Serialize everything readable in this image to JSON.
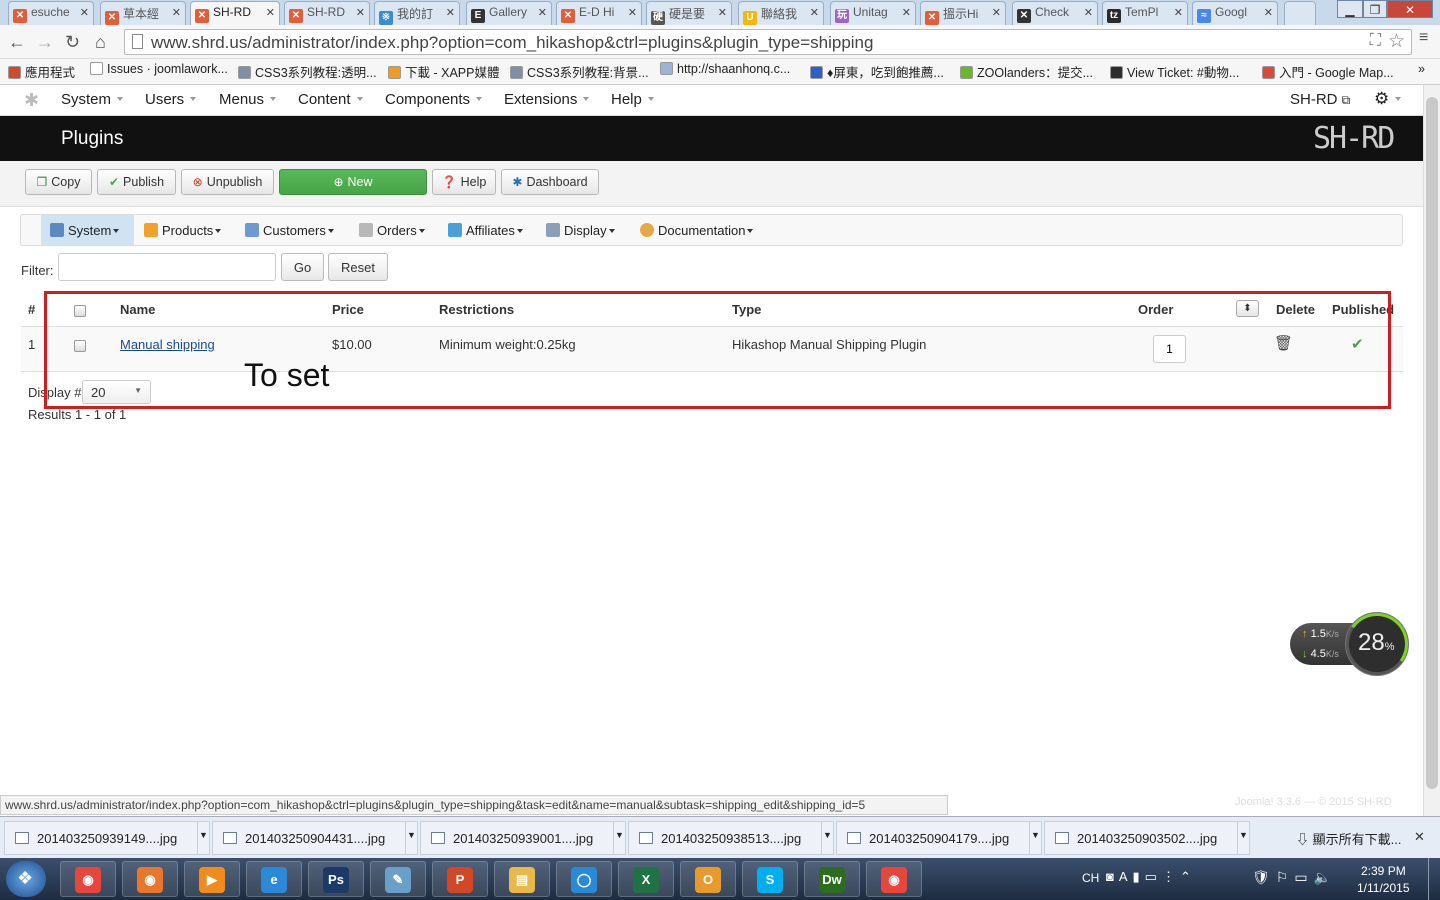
{
  "browser": {
    "tabs": [
      {
        "label": "esuche",
        "fav_color": "#e45d3a",
        "fav_glyph": "✕"
      },
      {
        "label": "草本經",
        "fav_color": "#e45d3a",
        "fav_glyph": "✕"
      },
      {
        "label": "SH-RD",
        "fav_color": "#e45d3a",
        "fav_glyph": "✕",
        "active": true
      },
      {
        "label": "SH-RD",
        "fav_color": "#e45d3a",
        "fav_glyph": "✕"
      },
      {
        "label": "我的訂",
        "fav_color": "#3a8ad6",
        "fav_glyph": "※"
      },
      {
        "label": "Gallery",
        "fav_color": "#333333",
        "fav_glyph": "E"
      },
      {
        "label": "E-D Hi",
        "fav_color": "#e45d3a",
        "fav_glyph": "✕"
      },
      {
        "label": "硬是要",
        "fav_color": "#555555",
        "fav_glyph": "硬"
      },
      {
        "label": "聯絡我",
        "fav_color": "#f2b90c",
        "fav_glyph": "U"
      },
      {
        "label": "Unitag",
        "fav_color": "#a064c8",
        "fav_glyph": "玩"
      },
      {
        "label": "搵示Hi",
        "fav_color": "#e45d3a",
        "fav_glyph": "✕"
      },
      {
        "label": "Check",
        "fav_color": "#333333",
        "fav_glyph": "✕"
      },
      {
        "label": "TemPl",
        "fav_color": "#2a2a2a",
        "fav_glyph": "tz"
      },
      {
        "label": "Googl",
        "fav_color": "#4a88e8",
        "fav_glyph": "≈"
      }
    ],
    "url": "www.shrd.us/administrator/index.php?option=com_hikashop&ctrl=plugins&plugin_type=shipping",
    "bookmarks": [
      {
        "label": "應用程式",
        "color": "#d04a2a"
      },
      {
        "label": "Issues · joomlawork...",
        "color": "#ffffff"
      },
      {
        "label": "CSS3系列教程:透明...",
        "color": "#7f8fa6"
      },
      {
        "label": "下載 - XAPP媒體",
        "color": "#f19a1c"
      },
      {
        "label": "CSS3系列教程:背景...",
        "color": "#7f8fa6"
      },
      {
        "label": "http://shaanhonq.c...",
        "color": "#9db4d6"
      },
      {
        "label": "♦屏東，吃到飽推薦...",
        "color": "#2d5fc7"
      },
      {
        "label": "ZOOlanders：提交...",
        "color": "#6ab82a"
      },
      {
        "label": "View Ticket: #動物...",
        "color": "#2d2d2d"
      },
      {
        "label": "入門 - Google Map...",
        "color": "#d94a3a"
      }
    ]
  },
  "joomla_menu": {
    "items": [
      "System",
      "Users",
      "Menus",
      "Content",
      "Components",
      "Extensions",
      "Help"
    ],
    "site_link": "SH-RD",
    "settings_icon": "gear-icon"
  },
  "header": {
    "title": "Plugins",
    "logo": "SH-RD"
  },
  "toolbar": {
    "copy": "Copy",
    "publish": "Publish",
    "unpublish": "Unpublish",
    "new": "New",
    "help": "Help",
    "dashboard": "Dashboard"
  },
  "hikashop_menu": [
    "System",
    "Products",
    "Customers",
    "Orders",
    "Affiliates",
    "Display",
    "Documentation"
  ],
  "filter": {
    "label": "Filter:",
    "value": "",
    "go": "Go",
    "reset": "Reset"
  },
  "table": {
    "headers": {
      "num": "#",
      "name": "Name",
      "price": "Price",
      "restrictions": "Restrictions",
      "type": "Type",
      "order": "Order",
      "delete": "Delete",
      "published": "Published"
    },
    "rows": [
      {
        "num": "1",
        "name": "Manual shipping",
        "price": "$10.00",
        "restrictions": "Minimum weight:0.25kg",
        "type": "Hikashop Manual Shipping Plugin",
        "order": "1",
        "published": true
      }
    ]
  },
  "annotation": {
    "text": "To set",
    "color": "#cc1f1f"
  },
  "pagination": {
    "display_label": "Display #",
    "display_value": "20",
    "results": "Results 1 - 1 of 1"
  },
  "footer_note": "Joomla! 3.3.6 — © 2015 SH-RD",
  "network_widget": {
    "up": "1.5",
    "down": "4.5",
    "unit": "K/s",
    "percent": "28",
    "percent_sign": "%"
  },
  "status_url": "www.shrd.us/administrator/index.php?option=com_hikashop&ctrl=plugins&plugin_type=shipping&task=edit&name=manual&subtask=shipping_edit&shipping_id=5",
  "downloads": {
    "files": [
      "201403250939149....jpg",
      "201403250904431....jpg",
      "201403250939001....jpg",
      "201403250938513....jpg",
      "201403250904179....jpg",
      "201403250903502....jpg"
    ],
    "show_all": "顯示所有下載..."
  },
  "taskbar": {
    "apps": [
      {
        "name": "chrome",
        "glyph": "◉",
        "color": "#e8453c"
      },
      {
        "name": "firefox",
        "glyph": "◉",
        "color": "#e8772c"
      },
      {
        "name": "media-player",
        "glyph": "▶",
        "color": "#f08c1c"
      },
      {
        "name": "internet-explorer",
        "glyph": "e",
        "color": "#2a8ad8"
      },
      {
        "name": "photoshop",
        "glyph": "Ps",
        "color": "#1b3a68"
      },
      {
        "name": "notepad",
        "glyph": "✎",
        "color": "#6aa0c8"
      },
      {
        "name": "powerpoint",
        "glyph": "P",
        "color": "#d24726"
      },
      {
        "name": "file-explorer",
        "glyph": "▤",
        "color": "#e8b84a"
      },
      {
        "name": "messenger",
        "glyph": "◯",
        "color": "#2a8ad8"
      },
      {
        "name": "excel",
        "glyph": "X",
        "color": "#207245"
      },
      {
        "name": "outlook",
        "glyph": "O",
        "color": "#e89a2c"
      },
      {
        "name": "skype",
        "glyph": "S",
        "color": "#00aff0"
      },
      {
        "name": "dreamweaver",
        "glyph": "Dw",
        "color": "#2a6e1e"
      },
      {
        "name": "chrome-2",
        "glyph": "◉",
        "color": "#e8453c"
      }
    ],
    "tray_lang": "CH",
    "time": "2:39 PM",
    "date": "1/11/2015"
  }
}
